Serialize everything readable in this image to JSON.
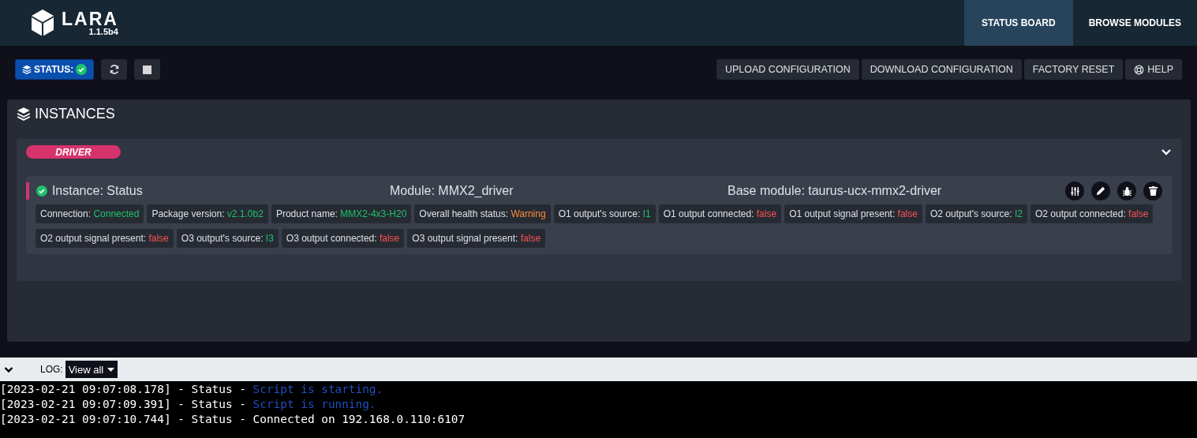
{
  "header": {
    "logo": "LARA",
    "version": "1.1.5b4",
    "nav": [
      {
        "label": "STATUS BOARD",
        "selected": true
      },
      {
        "label": "BROWSE MODULES",
        "selected": false
      }
    ]
  },
  "toolbar": {
    "status_label": "STATUS:",
    "status_ok": true,
    "actions": [
      "UPLOAD CONFIGURATION",
      "DOWNLOAD CONFIGURATION",
      "FACTORY RESET",
      "HELP"
    ]
  },
  "instances": {
    "title": "INSTANCES",
    "groups": [
      {
        "tag": "DRIVER",
        "expanded": true,
        "items": [
          {
            "ok": true,
            "name": "Instance: Status",
            "module": "Module: MMX2_driver",
            "base_module": "Base module: taurus-ucx-mmx2-driver",
            "properties": [
              {
                "label": "Connection:",
                "value": "Connected",
                "color": "#1ec26a"
              },
              {
                "label": "Package version:",
                "value": "v2.1.0b2",
                "color": "#1ec26a"
              },
              {
                "label": "Product name:",
                "value": "MMX2-4x3-H20",
                "color": "#1ec26a"
              },
              {
                "label": "Overall health status:",
                "value": "Warning",
                "color": "#fd8c3a"
              },
              {
                "label": "O1 output's source:",
                "value": "I1",
                "color": "#1ec26a"
              },
              {
                "label": "O1 output connected:",
                "value": "false",
                "color": "#fa5252"
              },
              {
                "label": "O1 output signal present:",
                "value": "false",
                "color": "#fa5252"
              },
              {
                "label": "O2 output's source:",
                "value": "I2",
                "color": "#1ec26a"
              },
              {
                "label": "O2 output connected:",
                "value": "false",
                "color": "#fa5252"
              },
              {
                "label": "O2 output signal present:",
                "value": "false",
                "color": "#fa5252"
              },
              {
                "label": "O3 output's source:",
                "value": "I3",
                "color": "#1ec26a"
              },
              {
                "label": "O3 output connected:",
                "value": "false",
                "color": "#fa5252"
              },
              {
                "label": "O3 output signal present:",
                "value": "false",
                "color": "#fa5252"
              }
            ]
          }
        ]
      }
    ]
  },
  "log": {
    "label": "LOG:",
    "filter": "View all",
    "entries": [
      {
        "prefix": "[2023-02-21 09:07:08.178] - Status -",
        "message": "Script is starting.",
        "color": "#1f4fc0"
      },
      {
        "prefix": "[2023-02-21 09:07:09.391] - Status -",
        "message": "Script is running.",
        "color": "#1f4fc0"
      },
      {
        "prefix": "[2023-02-21 09:07:10.744] - Status -",
        "message": "Connected on 192.168.0.110:6107",
        "color": "#ffffff"
      }
    ]
  }
}
